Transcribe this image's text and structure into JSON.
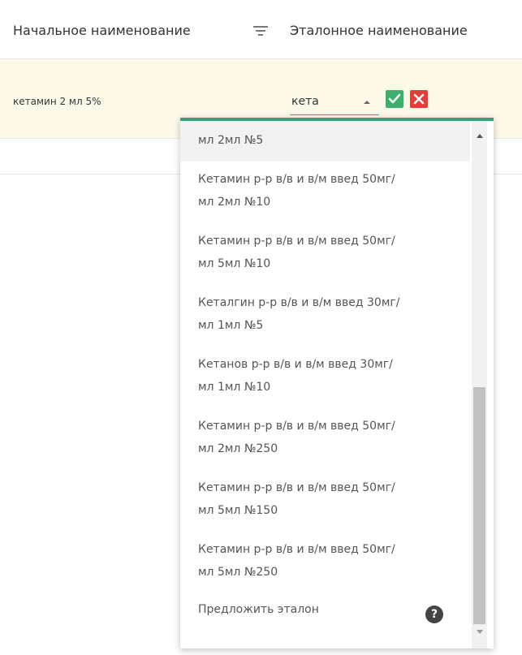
{
  "header": {
    "col_initial": "Начальное наименование",
    "col_etalon": "Эталонное наименование",
    "filter_icon": "filter-lines-icon"
  },
  "row": {
    "initial_name": "кетамин 2 мл 5%",
    "input_value": "кета",
    "confirm_icon": "checkmark-icon",
    "cancel_icon": "close-icon",
    "confirm_color": "#3fae6b",
    "cancel_color": "#e0403a"
  },
  "dropdown": {
    "accent": "#3a9f7d",
    "options": [
      {
        "line1": "",
        "line2": "мл 2мл №5"
      },
      {
        "line1": "Кетамин р-р в/в и в/м введ 50мг/",
        "line2": "мл 2мл №10"
      },
      {
        "line1": "Кетамин р-р в/в и в/м введ 50мг/",
        "line2": "мл 5мл №10"
      },
      {
        "line1": "Кеталгин р-р в/в и в/м введ 30мг/",
        "line2": "мл 1мл №5"
      },
      {
        "line1": "Кетанов р-р в/в и в/м введ 30мг/",
        "line2": "мл 1мл №10"
      },
      {
        "line1": "Кетамин р-р в/в и в/м введ 50мг/",
        "line2": "мл 2мл №250"
      },
      {
        "line1": "Кетамин р-р в/в и в/м введ 50мг/",
        "line2": "мл 5мл №150"
      },
      {
        "line1": "Кетамин р-р в/в и в/м введ 50мг/",
        "line2": "мл 5мл №250"
      }
    ],
    "suggest_label": "Предложить эталон",
    "help_symbol": "?"
  }
}
